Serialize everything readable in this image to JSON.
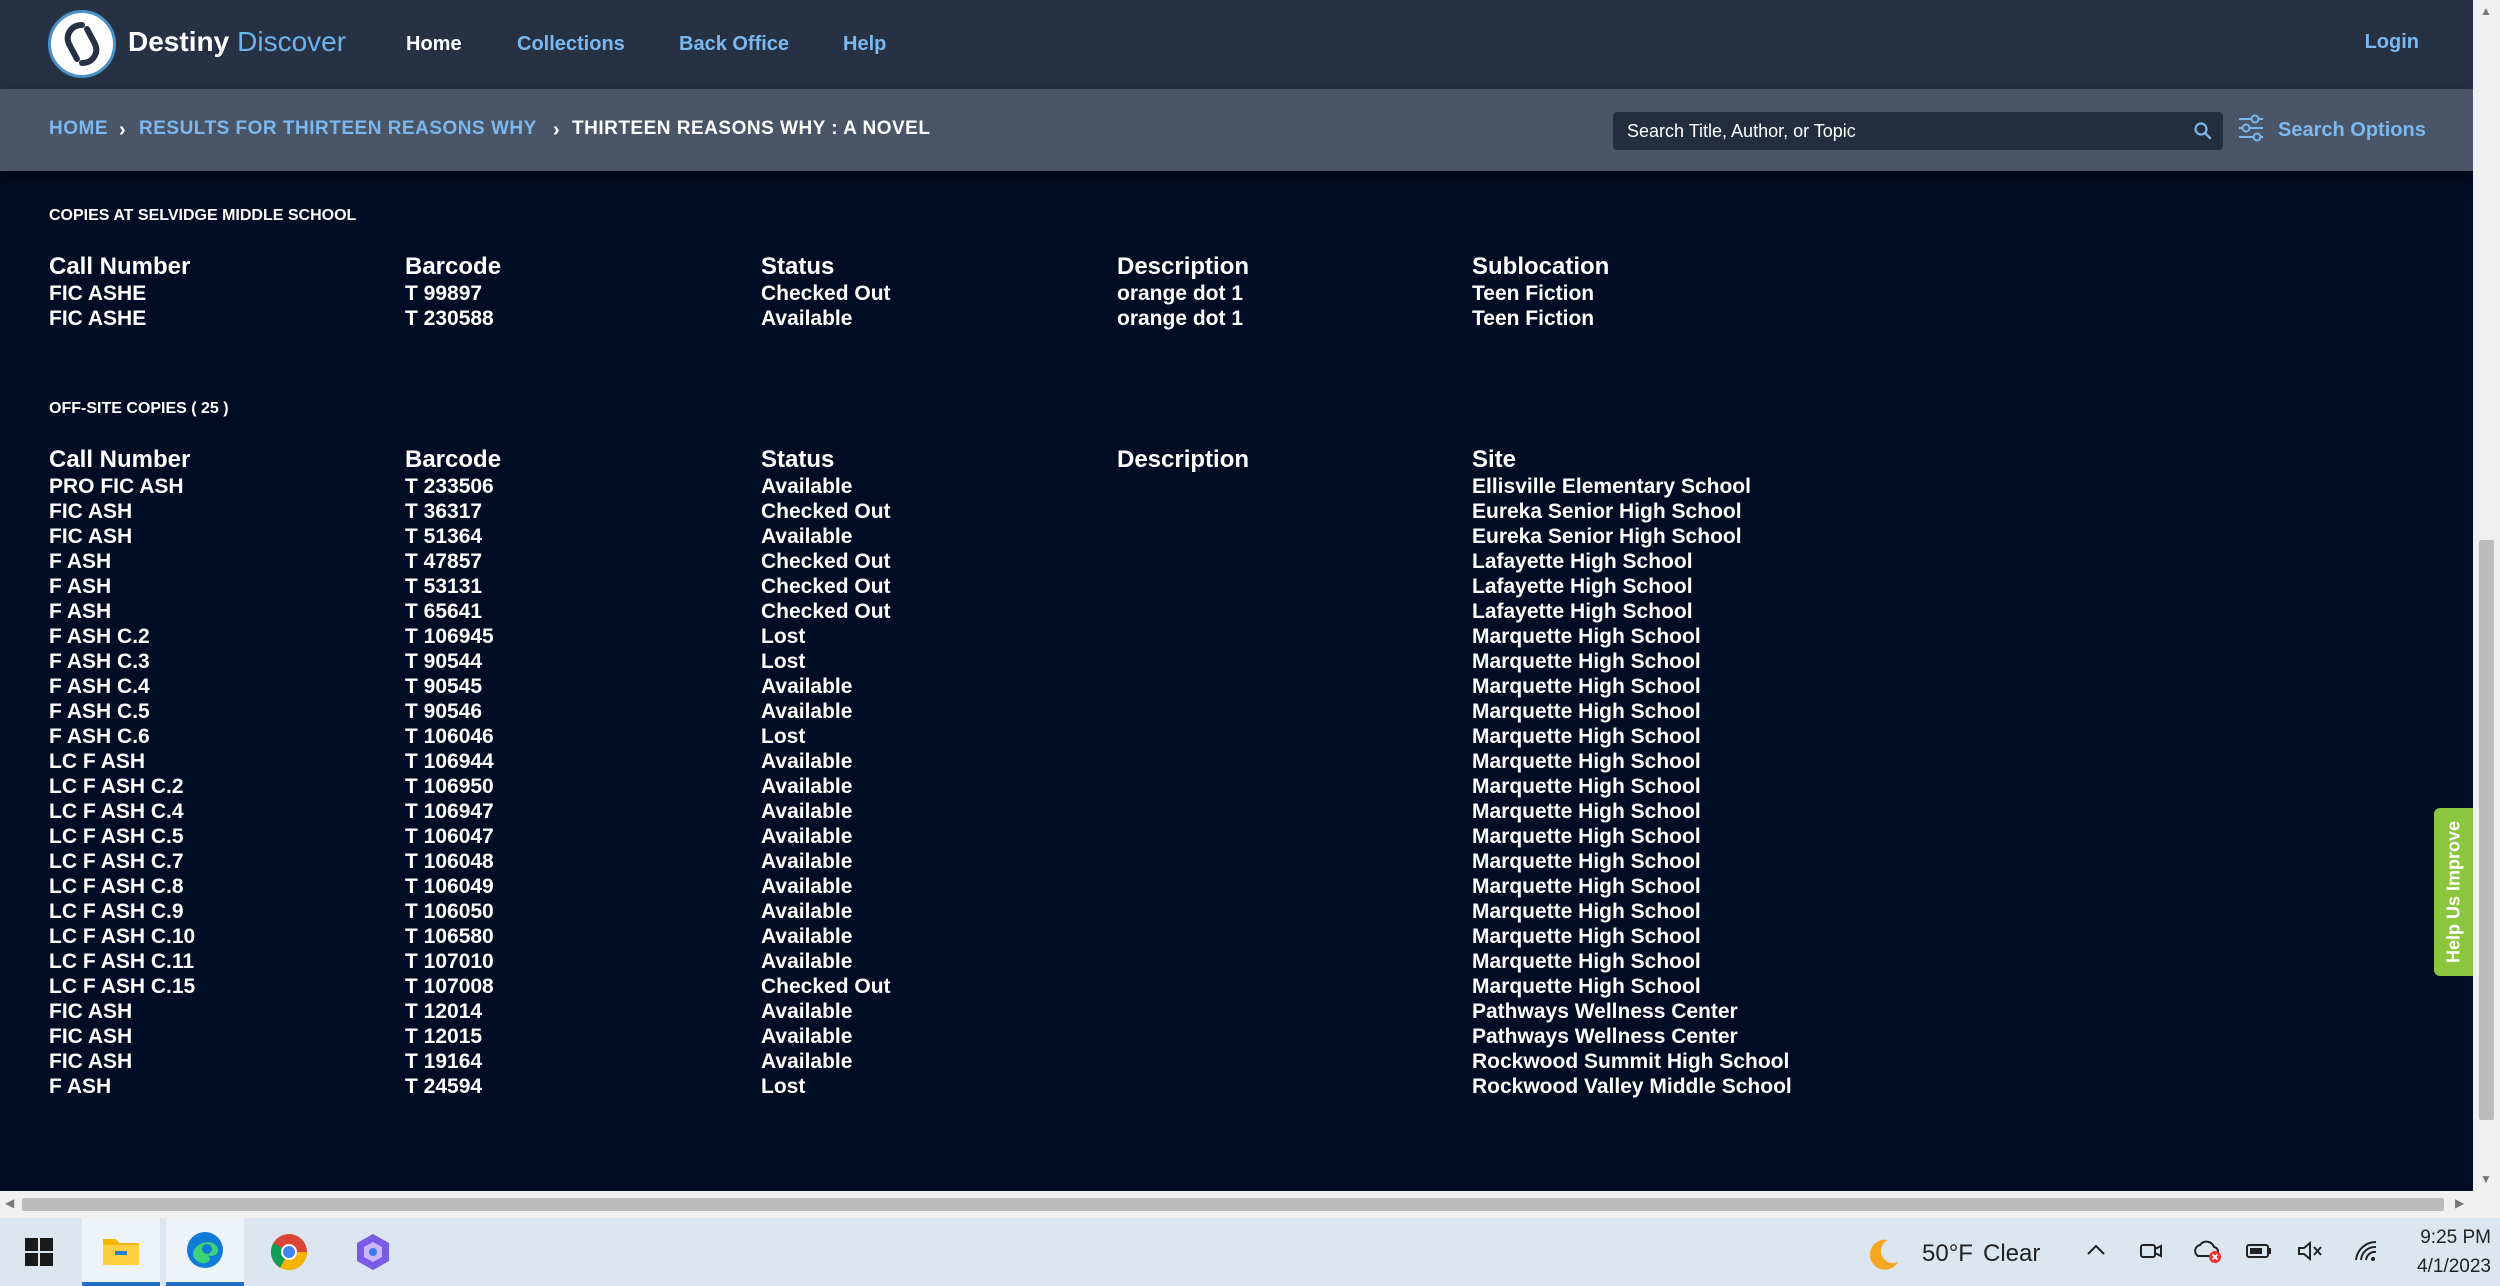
{
  "header": {
    "brand_main": "Destiny",
    "brand_accent": "Discover",
    "nav": [
      "Home",
      "Collections",
      "Back Office",
      "Help"
    ],
    "login": "Login"
  },
  "breadcrumb": {
    "home": "HOME",
    "results": "RESULTS FOR THIRTEEN REASONS WHY",
    "current": "THIRTEEN REASONS WHY : A NOVEL"
  },
  "search": {
    "placeholder": "Search Title, Author, or Topic",
    "options_label": "Search Options"
  },
  "local_copies": {
    "title": "COPIES AT SELVIDGE MIDDLE SCHOOL",
    "headers": [
      "Call Number",
      "Barcode",
      "Status",
      "Description",
      "Sublocation"
    ],
    "rows": [
      [
        "FIC ASHE",
        "T 99897",
        "Checked Out",
        "orange dot 1",
        "Teen Fiction"
      ],
      [
        "FIC ASHE",
        "T 230588",
        "Available",
        "orange dot 1",
        "Teen Fiction"
      ]
    ]
  },
  "offsite_copies": {
    "title": "OFF-SITE COPIES ( 25 )",
    "headers": [
      "Call Number",
      "Barcode",
      "Status",
      "Description",
      "Site"
    ],
    "rows": [
      [
        "PRO FIC ASH",
        "T 233506",
        "Available",
        "",
        "Ellisville Elementary School"
      ],
      [
        "FIC ASH",
        "T 36317",
        "Checked Out",
        "",
        "Eureka Senior High School"
      ],
      [
        "FIC ASH",
        "T 51364",
        "Available",
        "",
        "Eureka Senior High School"
      ],
      [
        "F ASH",
        "T 47857",
        "Checked Out",
        "",
        "Lafayette High School"
      ],
      [
        "F ASH",
        "T 53131",
        "Checked Out",
        "",
        "Lafayette High School"
      ],
      [
        "F ASH",
        "T 65641",
        "Checked Out",
        "",
        "Lafayette High School"
      ],
      [
        "F ASH C.2",
        "T 106945",
        "Lost",
        "",
        "Marquette High School"
      ],
      [
        "F ASH C.3",
        "T 90544",
        "Lost",
        "",
        "Marquette High School"
      ],
      [
        "F ASH C.4",
        "T 90545",
        "Available",
        "",
        "Marquette High School"
      ],
      [
        "F ASH C.5",
        "T 90546",
        "Available",
        "",
        "Marquette High School"
      ],
      [
        "F ASH C.6",
        "T 106046",
        "Lost",
        "",
        "Marquette High School"
      ],
      [
        "LC F ASH",
        "T 106944",
        "Available",
        "",
        "Marquette High School"
      ],
      [
        "LC F ASH C.2",
        "T 106950",
        "Available",
        "",
        "Marquette High School"
      ],
      [
        "LC F ASH C.4",
        "T 106947",
        "Available",
        "",
        "Marquette High School"
      ],
      [
        "LC F ASH C.5",
        "T 106047",
        "Available",
        "",
        "Marquette High School"
      ],
      [
        "LC F ASH C.7",
        "T 106048",
        "Available",
        "",
        "Marquette High School"
      ],
      [
        "LC F ASH C.8",
        "T 106049",
        "Available",
        "",
        "Marquette High School"
      ],
      [
        "LC F ASH C.9",
        "T 106050",
        "Available",
        "",
        "Marquette High School"
      ],
      [
        "LC F ASH C.10",
        "T 106580",
        "Available",
        "",
        "Marquette High School"
      ],
      [
        "LC F ASH C.11",
        "T 107010",
        "Available",
        "",
        "Marquette High School"
      ],
      [
        "LC F ASH C.15",
        "T 107008",
        "Checked Out",
        "",
        "Marquette High School"
      ],
      [
        "FIC ASH",
        "T 12014",
        "Available",
        "",
        "Pathways Wellness Center"
      ],
      [
        "FIC ASH",
        "T 12015",
        "Available",
        "",
        "Pathways Wellness Center"
      ],
      [
        "FIC ASH",
        "T 19164",
        "Available",
        "",
        "Rockwood Summit High School"
      ],
      [
        "F ASH",
        "T 24594",
        "Lost",
        "",
        "Rockwood Valley Middle School"
      ]
    ]
  },
  "feedback_tab": "Help Us Improve",
  "taskbar": {
    "apps": [
      "start-icon",
      "file-explorer-icon",
      "edge-icon",
      "chrome-icon",
      "copilot-icon"
    ],
    "weather_temp": "50°F",
    "weather_condition": "Clear",
    "time": "9:25 PM",
    "date": "4/1/2023"
  },
  "colors": {
    "page_bg": "#000d24",
    "nav_bg": "#263244",
    "crumb_bg": "#4a5667",
    "link": "#7ab8ef",
    "feedback": "#8cc63f"
  }
}
